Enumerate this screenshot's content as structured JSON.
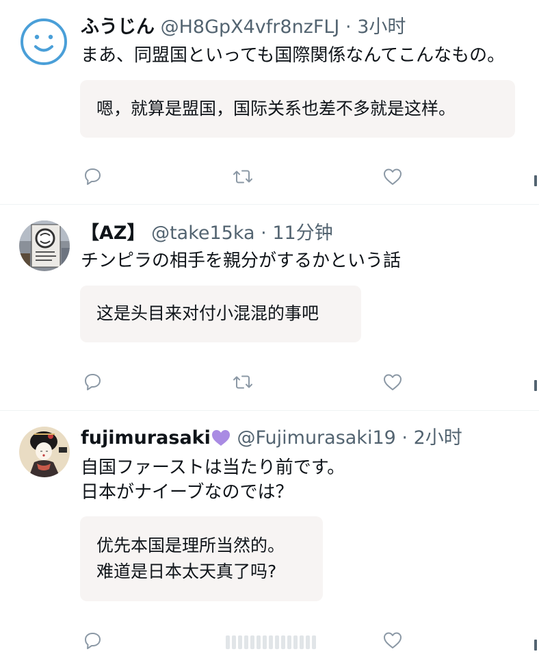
{
  "posts": [
    {
      "display_name": "ふうじん",
      "handle": "@H8GpX4vfr8nzFLJ",
      "separator": "·",
      "time": "3小时",
      "text_lines": [
        "まあ、同盟国といっても国際関係なんてこんなもの。"
      ],
      "translation_lines": [
        "嗯，就算是盟国，国际关系也差不多就是这样。"
      ],
      "avatar_icon": "smiley-face-icon"
    },
    {
      "display_name": "【AZ】",
      "handle": "@take15ka",
      "separator": "·",
      "time": "11分钟",
      "text_lines": [
        "チンピラの相手を親分がするかという話"
      ],
      "translation_lines": [
        "这是头目来对付小混混的事吧"
      ],
      "avatar_icon": "storefront-photo-icon"
    },
    {
      "display_name": "fujimurasaki",
      "handle": "@Fujimurasaki19",
      "separator": "·",
      "time": "2小时",
      "text_lines": [
        "自国ファーストは当たり前です。",
        "日本がナイーブなのでは？"
      ],
      "translation_lines": [
        "优先本国是理所当然的。",
        "难道是日本太天真了吗?"
      ],
      "avatar_icon": "geisha-painting-icon"
    }
  ],
  "actions": {
    "reply_icon": "reply-icon",
    "retweet_icon": "retweet-icon",
    "like_icon": "heart-icon",
    "share_icon": "share-icon"
  },
  "colors": {
    "text_primary": "#0f1419",
    "text_secondary": "#536471",
    "icon_gray": "#8b98a5",
    "translation_bg": "#f7f4f3",
    "avatar_blue": "#4a9fd8",
    "purple_heart": "#a98be3"
  }
}
